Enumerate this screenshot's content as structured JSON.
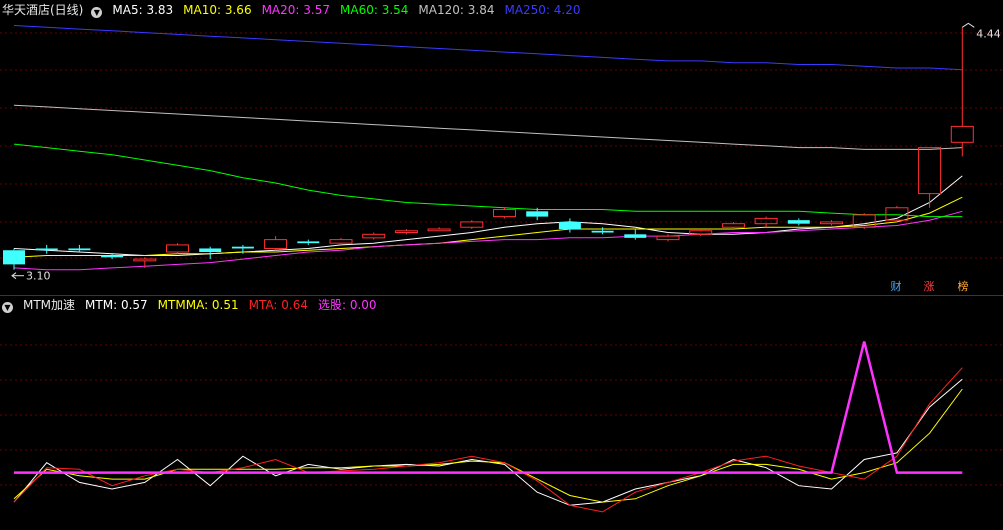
{
  "header": {
    "stock_title": "华天酒店(日线)",
    "ma": [
      {
        "label": "MA5",
        "value": "3.83",
        "color": "#ffffff"
      },
      {
        "label": "MA10",
        "value": "3.66",
        "color": "#ffff00"
      },
      {
        "label": "MA20",
        "value": "3.57",
        "color": "#ff33ff"
      },
      {
        "label": "MA60",
        "value": "3.54",
        "color": "#00ff00"
      },
      {
        "label": "MA120",
        "value": "3.84",
        "color": "#c0c0c0"
      },
      {
        "label": "MA250",
        "value": "4.20",
        "color": "#3a3aff"
      }
    ]
  },
  "indicator": {
    "name": "MTM加速",
    "items": [
      {
        "label": "MTM",
        "value": "0.57",
        "color": "#ffffff"
      },
      {
        "label": "MTMMA",
        "value": "0.51",
        "color": "#ffff00"
      },
      {
        "label": "MTA",
        "value": "0.64",
        "color": "#ff2020"
      },
      {
        "label": "选股",
        "value": "0.00",
        "color": "#ff33ff"
      }
    ]
  },
  "badges": [
    {
      "text": "财",
      "color": "#4da6ff"
    },
    {
      "text": "涨",
      "color": "#ff4040"
    },
    {
      "text": "榜",
      "color": "#ffaa33"
    }
  ],
  "annotations": {
    "high_label": "4.44",
    "low_label": "3.10"
  },
  "colors": {
    "up": "#ff3030",
    "down": "#40ffff",
    "grid": "#6a0000",
    "divider": "#b00000"
  },
  "chart_data": [
    {
      "type": "candlestick",
      "title": "华天酒店(日线)",
      "ylim": [
        3.04,
        4.47
      ],
      "candles": [
        [
          3.18,
          3.1,
          3.19,
          3.07
        ],
        [
          3.19,
          3.18,
          3.21,
          3.16
        ],
        [
          3.19,
          3.18,
          3.21,
          3.17
        ],
        [
          3.15,
          3.14,
          3.16,
          3.13
        ],
        [
          3.12,
          3.13,
          3.14,
          3.08
        ],
        [
          3.17,
          3.21,
          3.22,
          3.16
        ],
        [
          3.19,
          3.17,
          3.2,
          3.13
        ],
        [
          3.2,
          3.19,
          3.21,
          3.16
        ],
        [
          3.19,
          3.24,
          3.26,
          3.18
        ],
        [
          3.23,
          3.22,
          3.24,
          3.21
        ],
        [
          3.22,
          3.24,
          3.25,
          3.21
        ],
        [
          3.25,
          3.27,
          3.28,
          3.24
        ],
        [
          3.28,
          3.29,
          3.3,
          3.27
        ],
        [
          3.29,
          3.3,
          3.31,
          3.29
        ],
        [
          3.31,
          3.34,
          3.35,
          3.3
        ],
        [
          3.37,
          3.41,
          3.42,
          3.36
        ],
        [
          3.4,
          3.37,
          3.42,
          3.35
        ],
        [
          3.34,
          3.3,
          3.36,
          3.28
        ],
        [
          3.29,
          3.28,
          3.31,
          3.27
        ],
        [
          3.27,
          3.25,
          3.3,
          3.24
        ],
        [
          3.24,
          3.26,
          3.27,
          3.23
        ],
        [
          3.27,
          3.29,
          3.3,
          3.26
        ],
        [
          3.31,
          3.33,
          3.34,
          3.3
        ],
        [
          3.33,
          3.36,
          3.37,
          3.31
        ],
        [
          3.35,
          3.33,
          3.36,
          3.32
        ],
        [
          3.33,
          3.34,
          3.35,
          3.32
        ],
        [
          3.31,
          3.38,
          3.39,
          3.3
        ],
        [
          3.35,
          3.42,
          3.43,
          3.34
        ],
        [
          3.5,
          3.76,
          3.76,
          3.42
        ],
        [
          3.79,
          3.88,
          4.44,
          3.71
        ]
      ],
      "ma_lines": [
        {
          "name": "MA5",
          "color": "#ffffff",
          "values": [
            3.19,
            3.18,
            3.17,
            3.16,
            3.15,
            3.15,
            3.16,
            3.17,
            3.18,
            3.19,
            3.21,
            3.22,
            3.24,
            3.26,
            3.28,
            3.31,
            3.33,
            3.34,
            3.33,
            3.31,
            3.28,
            3.27,
            3.27,
            3.28,
            3.3,
            3.31,
            3.33,
            3.36,
            3.45,
            3.6
          ]
        },
        {
          "name": "MA10",
          "color": "#ffff00",
          "values": [
            3.14,
            3.15,
            3.15,
            3.15,
            3.15,
            3.16,
            3.16,
            3.17,
            3.17,
            3.18,
            3.19,
            3.2,
            3.21,
            3.22,
            3.24,
            3.26,
            3.28,
            3.3,
            3.3,
            3.3,
            3.3,
            3.3,
            3.3,
            3.31,
            3.31,
            3.31,
            3.32,
            3.34,
            3.39,
            3.48
          ]
        },
        {
          "name": "MA20",
          "color": "#ff33ff",
          "values": [
            3.08,
            3.07,
            3.07,
            3.08,
            3.09,
            3.1,
            3.11,
            3.13,
            3.15,
            3.17,
            3.18,
            3.2,
            3.21,
            3.22,
            3.23,
            3.24,
            3.24,
            3.25,
            3.25,
            3.26,
            3.26,
            3.27,
            3.28,
            3.28,
            3.29,
            3.3,
            3.31,
            3.32,
            3.35,
            3.4
          ]
        },
        {
          "name": "MA60",
          "color": "#00ff00",
          "values": [
            3.78,
            3.76,
            3.74,
            3.72,
            3.69,
            3.66,
            3.63,
            3.59,
            3.56,
            3.52,
            3.49,
            3.47,
            3.45,
            3.44,
            3.43,
            3.42,
            3.41,
            3.41,
            3.41,
            3.4,
            3.4,
            3.4,
            3.4,
            3.4,
            3.4,
            3.39,
            3.38,
            3.38,
            3.37,
            3.37
          ]
        },
        {
          "name": "MA120",
          "color": "#c0c0c0",
          "values": [
            4.0,
            3.99,
            3.98,
            3.97,
            3.96,
            3.95,
            3.94,
            3.93,
            3.92,
            3.91,
            3.9,
            3.89,
            3.88,
            3.87,
            3.86,
            3.85,
            3.84,
            3.83,
            3.82,
            3.81,
            3.8,
            3.79,
            3.78,
            3.77,
            3.76,
            3.76,
            3.75,
            3.75,
            3.75,
            3.76
          ]
        },
        {
          "name": "MA250",
          "color": "#3a3aff",
          "values": [
            4.45,
            4.44,
            4.43,
            4.42,
            4.41,
            4.4,
            4.39,
            4.38,
            4.37,
            4.36,
            4.35,
            4.34,
            4.33,
            4.32,
            4.31,
            4.3,
            4.29,
            4.28,
            4.27,
            4.26,
            4.25,
            4.25,
            4.24,
            4.24,
            4.23,
            4.23,
            4.22,
            4.21,
            4.21,
            4.2
          ]
        }
      ]
    },
    {
      "type": "line",
      "title": "MTM加速",
      "ylim": [
        -0.32,
        0.98
      ],
      "series": [
        {
          "name": "MTM",
          "color": "#ffffff",
          "values": [
            -0.18,
            0.06,
            -0.06,
            -0.1,
            -0.06,
            0.08,
            -0.08,
            0.1,
            -0.02,
            0.05,
            0.02,
            0.04,
            0.05,
            0.04,
            0.08,
            0.05,
            -0.12,
            -0.2,
            -0.18,
            -0.1,
            -0.06,
            -0.02,
            0.08,
            0.03,
            -0.08,
            -0.1,
            0.08,
            0.12,
            0.4,
            0.57
          ]
        },
        {
          "name": "MTMMA",
          "color": "#ffff00",
          "values": [
            -0.16,
            0.02,
            -0.02,
            -0.04,
            -0.04,
            0.02,
            0.02,
            0.02,
            0.02,
            0.03,
            0.03,
            0.04,
            0.04,
            0.05,
            0.07,
            0.06,
            -0.04,
            -0.14,
            -0.18,
            -0.16,
            -0.08,
            -0.02,
            0.05,
            0.05,
            0.02,
            -0.04,
            0.0,
            0.06,
            0.24,
            0.51
          ]
        },
        {
          "name": "MTA",
          "color": "#ff2020",
          "values": [
            -0.18,
            0.03,
            0.02,
            -0.08,
            -0.02,
            0.02,
            0.0,
            0.03,
            0.08,
            0.0,
            0.01,
            0.02,
            0.04,
            0.06,
            0.1,
            0.06,
            -0.05,
            -0.2,
            -0.24,
            -0.12,
            -0.06,
            0.0,
            0.07,
            0.1,
            0.04,
            0.0,
            -0.04,
            0.1,
            0.42,
            0.64
          ]
        },
        {
          "name": "选股",
          "color": "#ff33ff",
          "values": [
            0,
            0,
            0,
            0,
            0,
            0,
            0,
            0,
            0,
            0,
            0,
            0,
            0,
            0,
            0,
            0,
            0,
            0,
            0,
            0,
            0,
            0,
            0,
            0,
            0,
            0,
            0.8,
            0,
            0,
            0
          ]
        }
      ]
    }
  ]
}
